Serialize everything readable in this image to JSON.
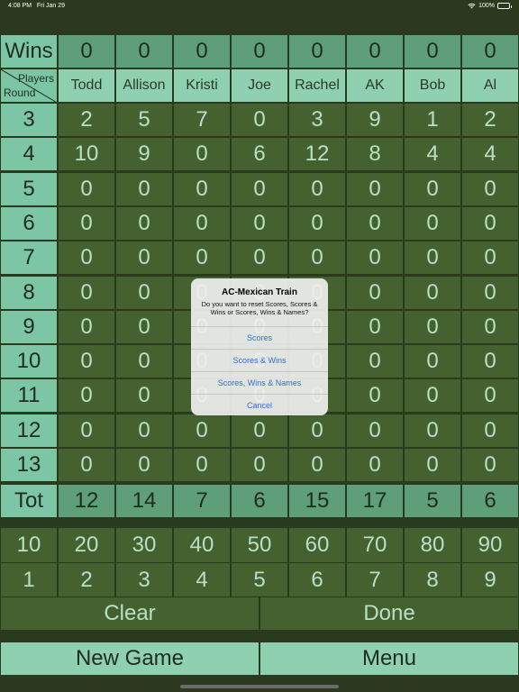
{
  "status_bar": {
    "time": "4:08 PM",
    "date": "Fri Jan 29",
    "battery": "100%"
  },
  "wins": {
    "label": "Wins",
    "values": [
      "0",
      "0",
      "0",
      "0",
      "0",
      "0",
      "0",
      "0"
    ]
  },
  "header": {
    "players_label": "Players",
    "round_label": "Round",
    "players": [
      "Todd",
      "Allison",
      "Kristi",
      "Joe",
      "Rachel",
      "AK",
      "Bob",
      "Al"
    ]
  },
  "rounds": [
    {
      "round": "3",
      "scores": [
        "2",
        "5",
        "7",
        "0",
        "3",
        "9",
        "1",
        "2"
      ]
    },
    {
      "round": "4",
      "scores": [
        "10",
        "9",
        "0",
        "6",
        "12",
        "8",
        "4",
        "4"
      ]
    },
    {
      "round": "5",
      "scores": [
        "0",
        "0",
        "0",
        "0",
        "0",
        "0",
        "0",
        "0"
      ]
    },
    {
      "round": "6",
      "scores": [
        "0",
        "0",
        "0",
        "0",
        "0",
        "0",
        "0",
        "0"
      ]
    },
    {
      "round": "7",
      "scores": [
        "0",
        "0",
        "0",
        "0",
        "0",
        "0",
        "0",
        "0"
      ]
    },
    {
      "round": "8",
      "scores": [
        "0",
        "0",
        "0",
        "0",
        "0",
        "0",
        "0",
        "0"
      ]
    },
    {
      "round": "9",
      "scores": [
        "0",
        "0",
        "0",
        "0",
        "0",
        "0",
        "0",
        "0"
      ]
    },
    {
      "round": "10",
      "scores": [
        "0",
        "0",
        "0",
        "0",
        "0",
        "0",
        "0",
        "0"
      ]
    },
    {
      "round": "11",
      "scores": [
        "0",
        "0",
        "0",
        "0",
        "0",
        "0",
        "0",
        "0"
      ]
    },
    {
      "round": "12",
      "scores": [
        "0",
        "0",
        "0",
        "0",
        "0",
        "0",
        "0",
        "0"
      ]
    },
    {
      "round": "13",
      "scores": [
        "0",
        "0",
        "0",
        "0",
        "0",
        "0",
        "0",
        "0"
      ]
    }
  ],
  "totals": {
    "label": "Tot",
    "values": [
      "12",
      "14",
      "7",
      "6",
      "15",
      "17",
      "5",
      "6"
    ]
  },
  "keypad": {
    "tens": [
      "10",
      "20",
      "30",
      "40",
      "50",
      "60",
      "70",
      "80",
      "90"
    ],
    "ones": [
      "1",
      "2",
      "3",
      "4",
      "5",
      "6",
      "7",
      "8",
      "9"
    ]
  },
  "buttons": {
    "clear": "Clear",
    "done": "Done",
    "new_game": "New Game",
    "menu": "Menu"
  },
  "dialog": {
    "title": "AC-Mexican Train",
    "message": "Do you want to reset Scores, Scores & Wins or Scores, Wins & Names?",
    "options": [
      "Scores",
      "Scores & Wins",
      "Scores, Wins & Names",
      "Cancel"
    ]
  },
  "colors": {
    "background": "#2b3a1f",
    "label_cell": "#7cc6a6",
    "score_cell": "#45612f",
    "total_cell": "#5e9e79",
    "dialog_button": "#2f6fd8"
  }
}
